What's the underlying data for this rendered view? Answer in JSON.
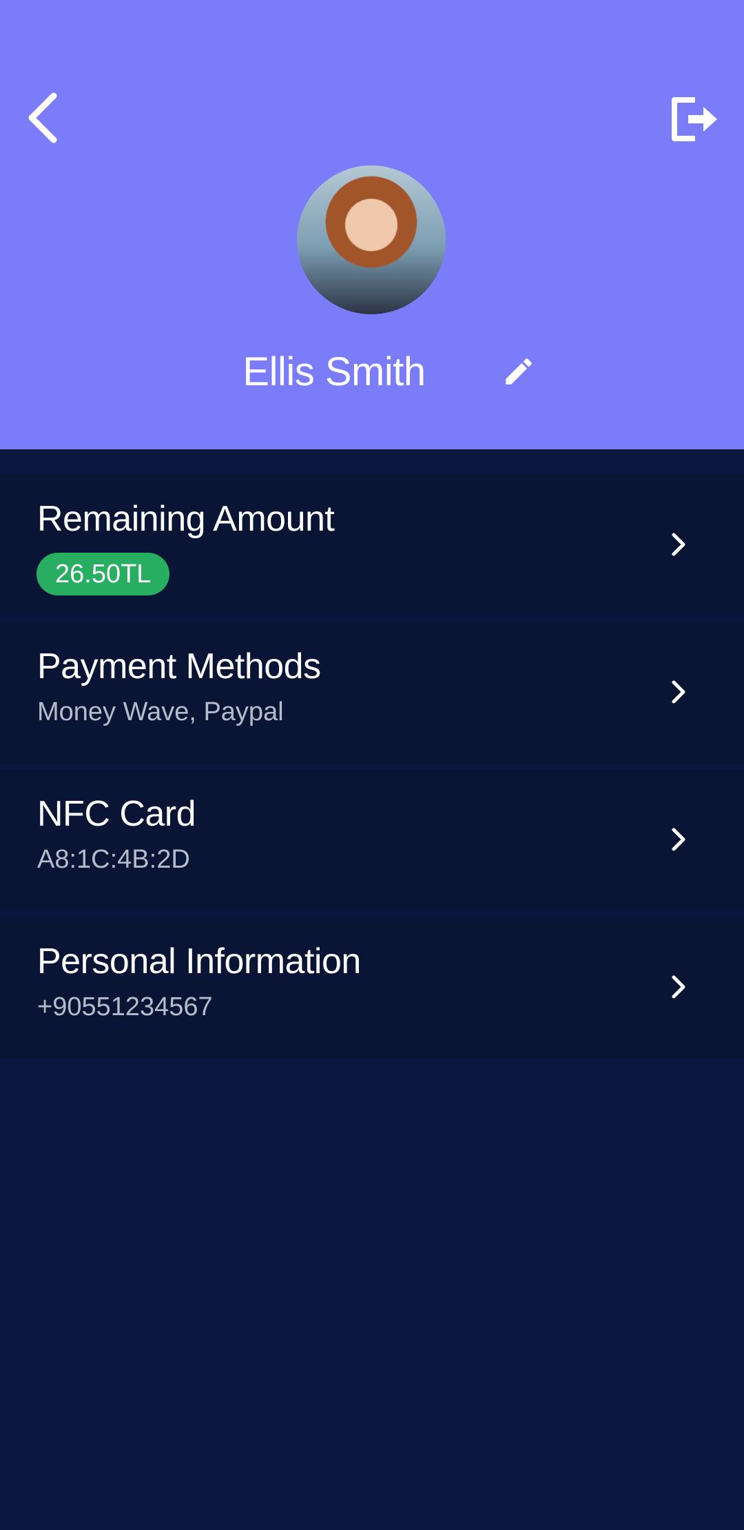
{
  "header": {
    "background_color": "#7b7cf9",
    "back_icon": "chevron-left-icon",
    "logout_icon": "logout-icon",
    "edit_icon": "pencil-icon",
    "user_name": "Ellis Smith"
  },
  "menu": {
    "items": [
      {
        "title": "Remaining Amount",
        "badge": "26.50TL",
        "badge_color": "#27ae60",
        "icon": "chevron-right-icon"
      },
      {
        "title": "Payment Methods",
        "subtitle": "Money Wave, Paypal",
        "icon": "chevron-right-icon"
      },
      {
        "title": "NFC Card",
        "subtitle": "A8:1C:4B:2D",
        "icon": "chevron-right-icon"
      },
      {
        "title": "Personal Information",
        "subtitle": "+90551234567",
        "icon": "chevron-right-icon"
      }
    ]
  },
  "colors": {
    "page_background": "#0c1740",
    "card_background": "#0a1535",
    "text_primary": "#ffffff",
    "text_secondary": "#b7bccb"
  }
}
